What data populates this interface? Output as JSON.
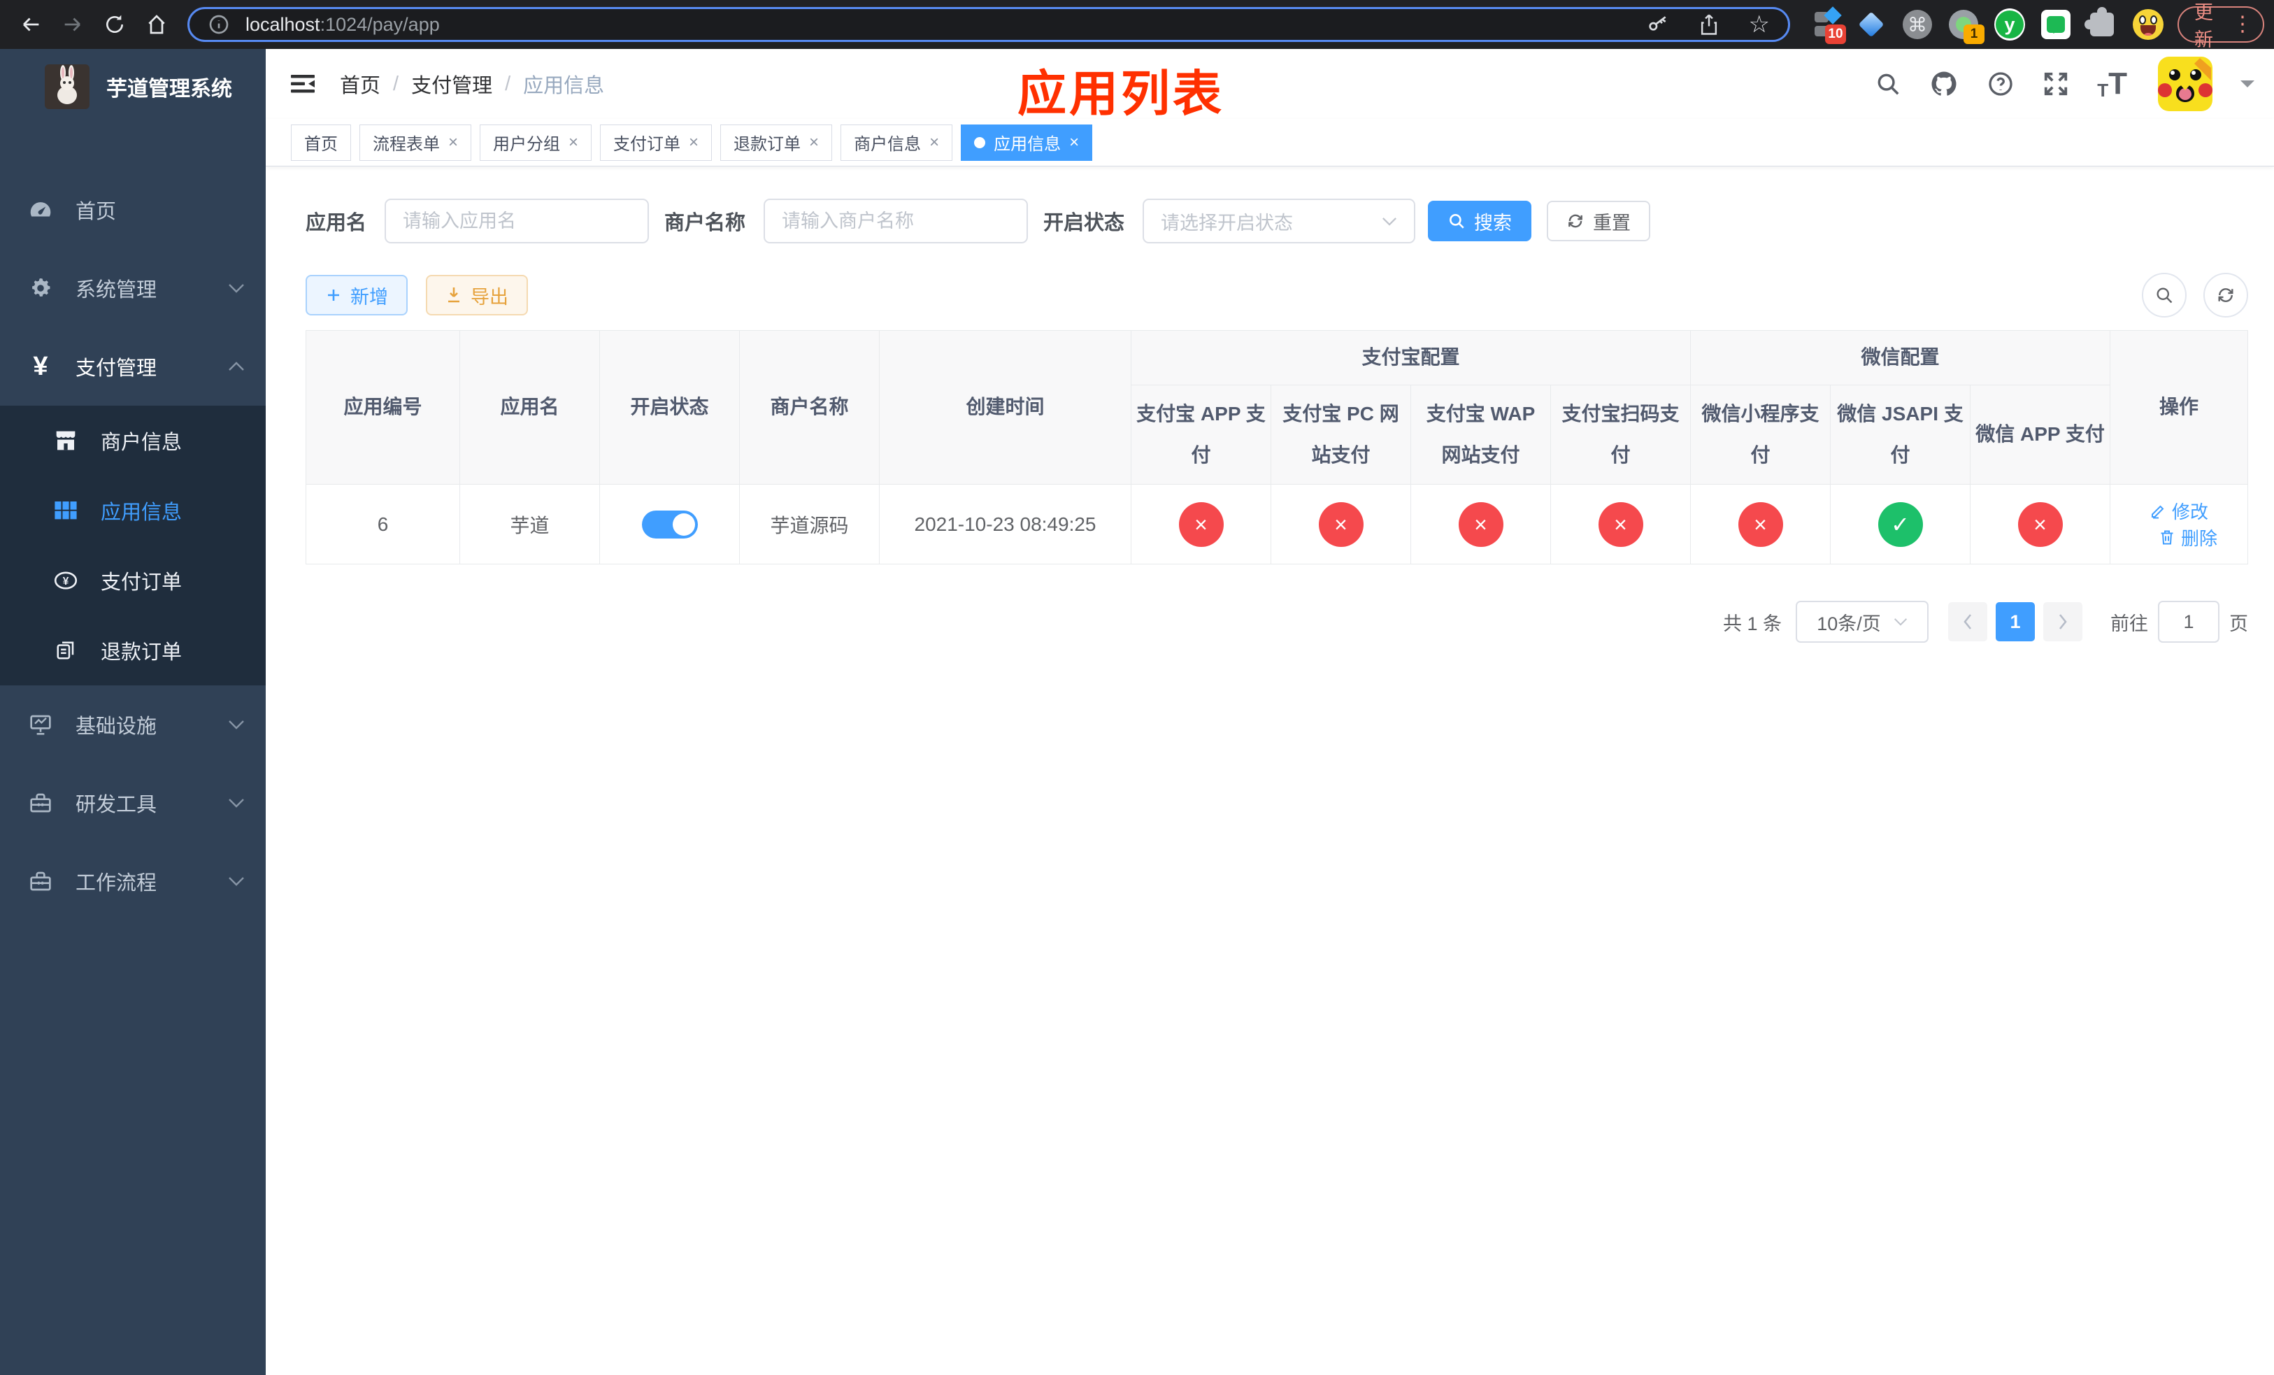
{
  "browser": {
    "url_host": "localhost",
    "url_path": ":1024/pay/app",
    "update_label": "更新",
    "extension_badges": {
      "first": "10",
      "fourth": "1"
    }
  },
  "sidebar": {
    "title": "芋道管理系统",
    "menu": [
      {
        "label": "首页"
      },
      {
        "label": "系统管理"
      },
      {
        "label": "支付管理"
      },
      {
        "label": "基础设施"
      },
      {
        "label": "研发工具"
      },
      {
        "label": "工作流程"
      }
    ],
    "payment_submenu": [
      {
        "label": "商户信息"
      },
      {
        "label": "应用信息",
        "active": true
      },
      {
        "label": "支付订单"
      },
      {
        "label": "退款订单"
      }
    ]
  },
  "header": {
    "breadcrumb": [
      "首页",
      "支付管理",
      "应用信息"
    ],
    "annotation": "应用列表"
  },
  "tabs": [
    {
      "label": "首页",
      "closable": false,
      "active": false
    },
    {
      "label": "流程表单",
      "closable": true,
      "active": false
    },
    {
      "label": "用户分组",
      "closable": true,
      "active": false
    },
    {
      "label": "支付订单",
      "closable": true,
      "active": false
    },
    {
      "label": "退款订单",
      "closable": true,
      "active": false
    },
    {
      "label": "商户信息",
      "closable": true,
      "active": false
    },
    {
      "label": "应用信息",
      "closable": true,
      "active": true
    }
  ],
  "filters": {
    "app_name": {
      "label": "应用名",
      "placeholder": "请输入应用名"
    },
    "merchant": {
      "label": "商户名称",
      "placeholder": "请输入商户名称"
    },
    "status": {
      "label": "开启状态",
      "placeholder": "请选择开启状态"
    },
    "search_label": "搜索",
    "reset_label": "重置"
  },
  "toolbar": {
    "add_label": "新增",
    "export_label": "导出"
  },
  "table": {
    "plain_columns": [
      "应用编号",
      "应用名",
      "开启状态",
      "商户名称",
      "创建时间"
    ],
    "alipay_group": {
      "label": "支付宝配置",
      "columns": [
        "支付宝 APP 支付",
        "支付宝 PC 网站支付",
        "支付宝 WAP 网站支付",
        "支付宝扫码支付"
      ]
    },
    "wechat_group": {
      "label": "微信配置",
      "columns": [
        "微信小程序支付",
        "微信 JSAPI 支付",
        "微信 APP 支付"
      ]
    },
    "actions_column": "操作",
    "rows": [
      {
        "app_id": "6",
        "app_name": "芋道",
        "enabled": true,
        "merchant_name": "芋道源码",
        "create_time": "2021-10-23 08:49:25",
        "pay_channels": [
          false,
          false,
          false,
          false,
          false,
          true,
          false
        ],
        "edit_label": "修改",
        "delete_label": "删除"
      }
    ]
  },
  "pagination": {
    "total_text": "共 1 条",
    "page_size_text": "10条/页",
    "current_page": "1",
    "goto_label": "前往",
    "goto_value": "1",
    "page_unit": "页"
  },
  "icons": {
    "yen": "¥",
    "star": "☆",
    "command": "⌘",
    "question": "?",
    "check": "✓",
    "cross": "×",
    "close": "×",
    "kebab": "⋮",
    "prev": "‹",
    "next": "›"
  },
  "colors": {
    "primary": "#409eff",
    "status_fail": "#f5494d",
    "status_ok": "#1dc06a",
    "annotation": "#ff3000",
    "sidebar_bg": "#304156",
    "submenu_bg": "#1f2d3d"
  }
}
